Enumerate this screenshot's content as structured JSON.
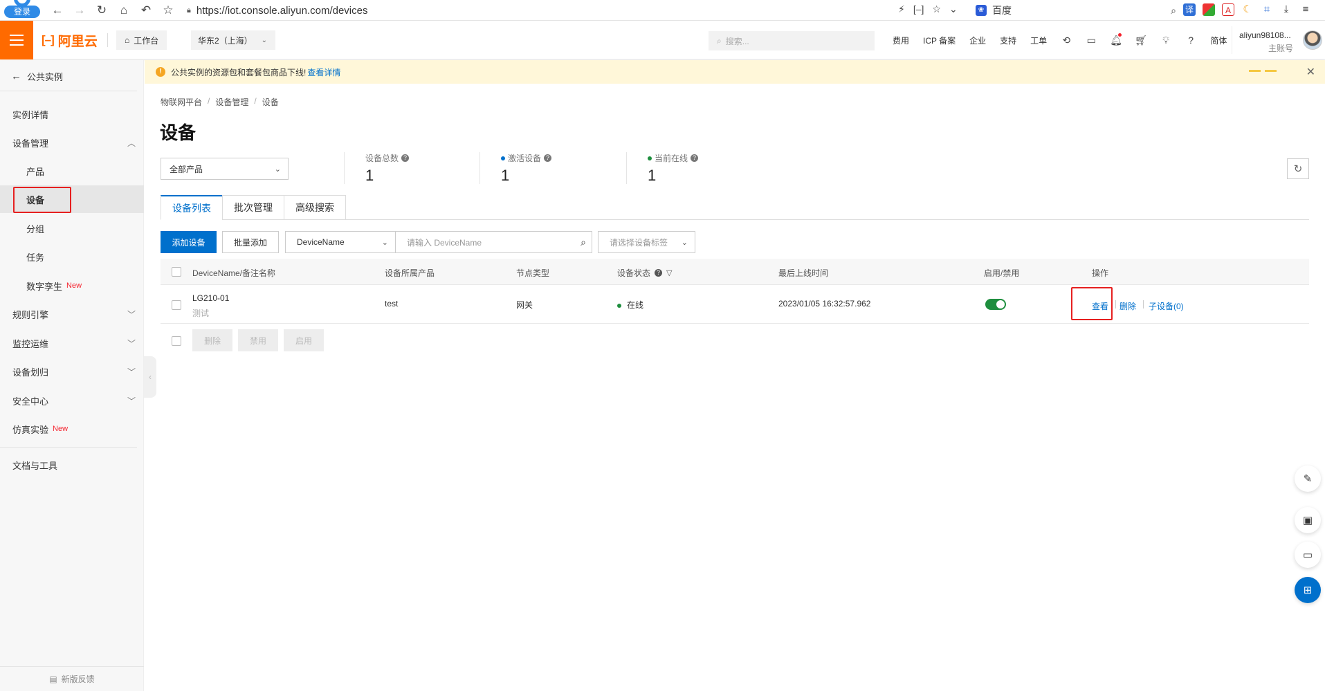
{
  "browser": {
    "login_label": "登录",
    "url": "https://iot.console.aliyun.com/devices",
    "search_engine": "百度"
  },
  "topbar": {
    "brand": "阿里云",
    "workbench": "工作台",
    "region": "华东2（上海）",
    "search_placeholder": "搜索...",
    "links": [
      "费用",
      "ICP 备案",
      "企业",
      "支持",
      "工单"
    ],
    "lang": "简体",
    "user_name": "aliyun98108...",
    "user_role": "主账号"
  },
  "sidebar": {
    "back": "公共实例",
    "items": [
      {
        "label": "实例详情"
      },
      {
        "label": "设备管理"
      },
      {
        "label": "产品"
      },
      {
        "label": "设备"
      },
      {
        "label": "分组"
      },
      {
        "label": "任务"
      },
      {
        "label": "数字孪生",
        "badge": "New"
      },
      {
        "label": "规则引擎"
      },
      {
        "label": "监控运维"
      },
      {
        "label": "设备划归"
      },
      {
        "label": "安全中心"
      },
      {
        "label": "仿真实验",
        "badge": "New"
      },
      {
        "label": "文档与工具"
      }
    ],
    "feedback": "新版反馈"
  },
  "notice": {
    "text": "公共实例的资源包和套餐包商品下线!",
    "link": "查看详情"
  },
  "breadcrumb": [
    "物联网平台",
    "设备管理",
    "设备"
  ],
  "page_title": "设备",
  "product_filter": "全部产品",
  "stats": [
    {
      "label": "设备总数",
      "value": "1"
    },
    {
      "label": "激活设备",
      "value": "1",
      "dot_color": "#0070cc"
    },
    {
      "label": "当前在线",
      "value": "1",
      "dot_color": "#1e8e3e"
    }
  ],
  "tabs": [
    "设备列表",
    "批次管理",
    "高级搜索"
  ],
  "toolbar": {
    "add": "添加设备",
    "batch_add": "批量添加",
    "search_field": "DeviceName",
    "search_placeholder": "请输入 DeviceName",
    "tag_placeholder": "请选择设备标签"
  },
  "table": {
    "headers": [
      "DeviceName/备注名称",
      "设备所属产品",
      "节点类型",
      "设备状态",
      "最后上线时间",
      "启用/禁用",
      "操作"
    ],
    "rows": [
      {
        "name": "LG210-01",
        "note": "测试",
        "product": "test",
        "node_type": "网关",
        "status": "在线",
        "last_online": "2023/01/05 16:32:57.962",
        "enabled": true,
        "actions": [
          "查看",
          "删除",
          "子设备(0)"
        ]
      }
    ],
    "bulk_actions": [
      "删除",
      "禁用",
      "启用"
    ]
  },
  "colors": {
    "brand": "#ff6a00",
    "primary": "#0070cc",
    "online": "#1e8e3e",
    "highlight": "#e62020"
  }
}
